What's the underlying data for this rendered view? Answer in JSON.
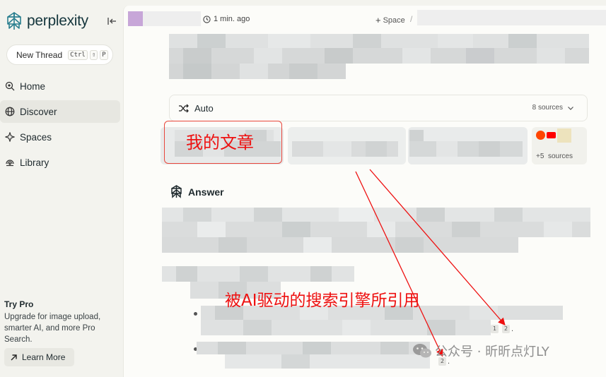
{
  "sidebar": {
    "brand": "perplexity",
    "new_thread": {
      "label": "New Thread",
      "shortcut": [
        "Ctrl",
        "⇧",
        "P"
      ]
    },
    "nav": [
      {
        "label": "Home",
        "icon": "home-search-icon"
      },
      {
        "label": "Discover",
        "icon": "globe-icon",
        "active": true
      },
      {
        "label": "Spaces",
        "icon": "spaces-icon"
      },
      {
        "label": "Library",
        "icon": "library-icon"
      }
    ],
    "try_pro": {
      "title": "Try Pro",
      "description": "Upgrade for image upload, smarter AI, and more Pro Search.",
      "button": "Learn More"
    }
  },
  "header": {
    "time": "1 min. ago",
    "space": "Space",
    "separator": "/"
  },
  "search": {
    "mode": "Auto",
    "sources_count": "8 sources"
  },
  "sources_more": {
    "count": "+5",
    "label": "sources"
  },
  "answer": {
    "title": "Answer",
    "citations": [
      "1",
      "2",
      "2"
    ]
  },
  "annotations": {
    "label_1": "我的文章",
    "label_2": "被AI驱动的搜索引擎所引用",
    "watermark": "公众号 · 昕昕点灯LY"
  },
  "colors": {
    "brand": "#15363d",
    "accent_red": "#e11111",
    "background": "#f3f3ee",
    "panel": "#fcfcf9"
  }
}
